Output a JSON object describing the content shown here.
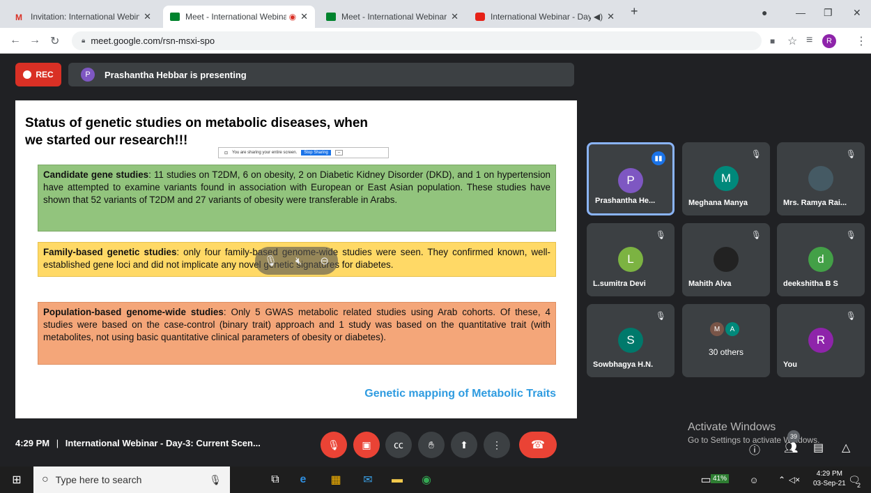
{
  "browser": {
    "tabs": [
      {
        "title": "Invitation: International Webinar",
        "favicon": "gmail-icon"
      },
      {
        "title": "Meet - International Webinar",
        "favicon": "meet-icon"
      },
      {
        "title": "Meet - International Webinar - D",
        "favicon": "meet-icon"
      },
      {
        "title": "International Webinar - Day-",
        "favicon": "youtube-icon"
      }
    ],
    "new_tab": "+",
    "url": "meet.google.com/rsn-msxi-spo",
    "profile_initial": "R"
  },
  "meet": {
    "rec_label": "REC",
    "presenter_initial": "P",
    "presenting_text": "Prashantha Hebbar is presenting",
    "slide": {
      "title": "Status of genetic studies on metabolic diseases, when we started our research!!!",
      "share_notice": "You are sharing your entire screen.",
      "stop_sharing": "Stop Sharing",
      "box1_heading": "Candidate gene studies",
      "box1_text": ": 11 studies on T2DM, 6 on obesity, 2 on Diabetic Kidney Disorder (DKD), and 1 on hypertension have attempted to examine variants found in association with European or East Asian population. These studies have shown that 52 variants of T2DM and 27 variants of obesity were transferable in Arabs.",
      "box2_heading": "Family-based genetic studies",
      "box2_text": ": only four family-based genome-wide studies were seen. They confirmed known, well-established gene loci and did not implicate any novel genetic signatures for diabetes.",
      "box3_heading": "Population-based genome-wide studies",
      "box3_text": ": Only 5 GWAS metabolic related studies using Arab cohorts. Of these, 4 studies were based on the case-control (binary trait) approach and 1 study was based on the quantitative trait (with metabolites, not using basic quantitative clinical parameters of obesity or diabetes).",
      "caption": "Genetic mapping of Metabolic Traits"
    },
    "participants": [
      {
        "name": "Prashantha He...",
        "initial": "P",
        "color": "#7e57c2",
        "speaking": true
      },
      {
        "name": "Meghana Manya",
        "initial": "M",
        "color": "#00897b"
      },
      {
        "name": "Mrs. Ramya Rai...",
        "initial": "",
        "color": "#455a64"
      },
      {
        "name": "L.sumitra Devi",
        "initial": "L",
        "color": "#7cb342"
      },
      {
        "name": "Mahith Alva",
        "initial": "",
        "color": "#222222"
      },
      {
        "name": "deekshitha B S",
        "initial": "d",
        "color": "#43a047"
      },
      {
        "name": "Sowbhagya H.N.",
        "initial": "S",
        "color": "#00796b"
      },
      {
        "name": "30 others",
        "initial": "",
        "color": ""
      },
      {
        "name": "You",
        "initial": "R",
        "color": "#8e24aa"
      }
    ],
    "others_initials": [
      "M",
      "A"
    ],
    "time": "4:29 PM",
    "separator": "|",
    "meeting_title": "International Webinar - Day-3: Current Scen...",
    "participant_count": "39",
    "activate_line1": "Activate Windows",
    "activate_line2": "Go to Settings to activate Windows."
  },
  "taskbar": {
    "search_placeholder": "Type here to search",
    "battery": "41%",
    "time": "4:29 PM",
    "date": "03-Sep-21",
    "notifications": "2"
  }
}
